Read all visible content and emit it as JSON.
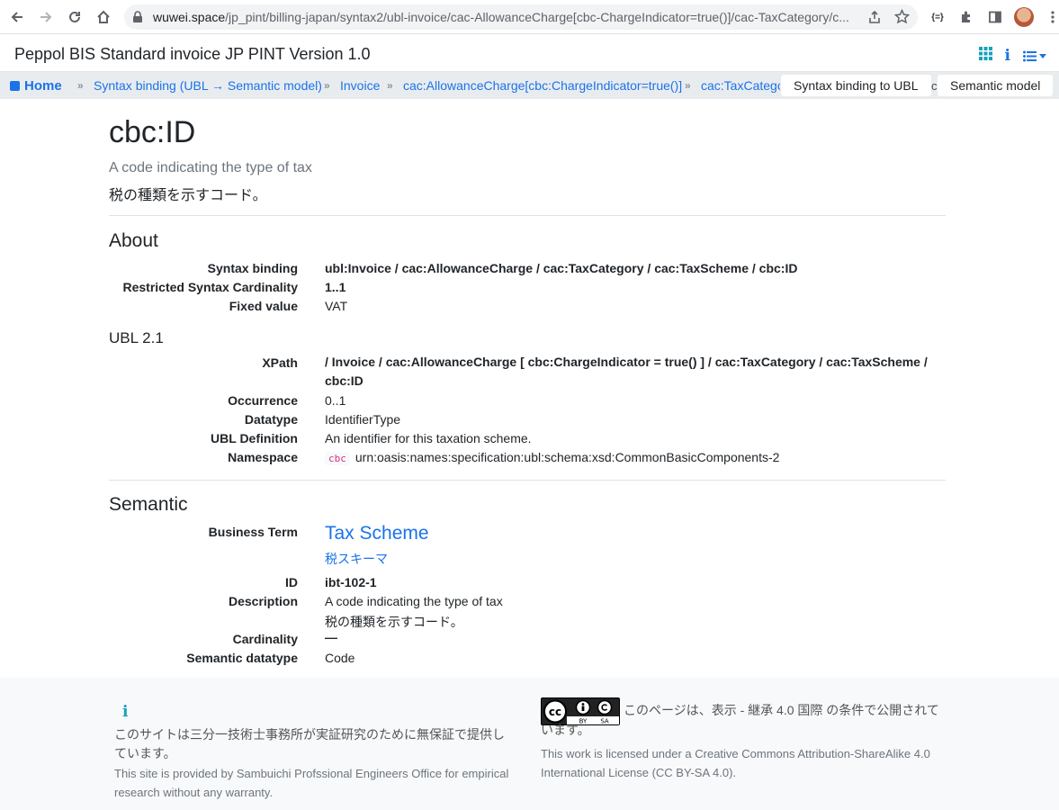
{
  "browser": {
    "url_host": "wuwei.space",
    "url_path": "/jp_pint/billing-japan/syntax2/ubl-invoice/cac-AllowanceCharge[cbc-ChargeIndicator=true()]/cac-TaxCategory/c...",
    "extension_label": "{=}"
  },
  "navbar": {
    "brand": "Peppol BIS Standard invoice JP PINT Version 1.0"
  },
  "breadcrumb": {
    "home": "Home",
    "items": [
      "Syntax binding (UBL → Semantic model)",
      "Invoice",
      "cac:AllowanceCharge[cbc:ChargeIndicator=true()]",
      "cac:TaxCatego"
    ],
    "tabs": [
      "Syntax binding to UBL",
      "Semantic model"
    ],
    "overflow": "c"
  },
  "header": {
    "title": "cbc:ID",
    "subtitle_en": "A code indicating the type of tax",
    "subtitle_ja": "税の種類を示すコード。"
  },
  "about": {
    "heading": "About",
    "rows": [
      {
        "label": "Syntax binding",
        "value": "ubl:Invoice / cac:AllowanceCharge / cac:TaxCategory / cac:TaxScheme / cbc:ID"
      },
      {
        "label": "Restricted Syntax Cardinality",
        "value": "1..1"
      },
      {
        "label": "Fixed value",
        "value": "VAT"
      }
    ]
  },
  "ubl": {
    "heading": "UBL 2.1",
    "rows": [
      {
        "label": "XPath",
        "value": "/ Invoice / cac:AllowanceCharge [ cbc:ChargeIndicator = true() ] / cac:TaxCategory / cac:TaxScheme / cbc:ID"
      },
      {
        "label": "Occurrence",
        "value": "0..1"
      },
      {
        "label": "Datatype",
        "value": "IdentifierType"
      },
      {
        "label": "UBL Definition",
        "value": "An identifier for this taxation scheme."
      },
      {
        "label": "Namespace",
        "prefix": "cbc",
        "value": "urn:oasis:names:specification:ubl:schema:xsd:CommonBasicComponents-2"
      }
    ]
  },
  "semantic": {
    "heading": "Semantic",
    "business_term_label": "Business Term",
    "business_term_en": "Tax Scheme",
    "business_term_ja": "税スキーマ",
    "rows": [
      {
        "label": "ID",
        "value": "ibt-102-1"
      },
      {
        "label": "Description",
        "value": "A code indicating the type of tax",
        "value2": "税の種類を示すコード。"
      },
      {
        "label": "Cardinality",
        "value": "—"
      },
      {
        "label": "Semantic datatype",
        "value": "Code"
      }
    ]
  },
  "footer": {
    "info_icon": "i",
    "notice_ja": "このサイトは三分一技術士事務所が実証研究のために無保証で提供しています。",
    "notice_en": "This site is provided by Sambuichi Profssional Engineers Office for empirical research without any warranty.",
    "license_ja": "このページは、表示 - 継承 4.0 国際 の条件で公開されています。",
    "license_en": "This work is licensed under a Creative Commons Attribution-ShareAlike 4.0 International License (CC BY-SA 4.0)."
  }
}
